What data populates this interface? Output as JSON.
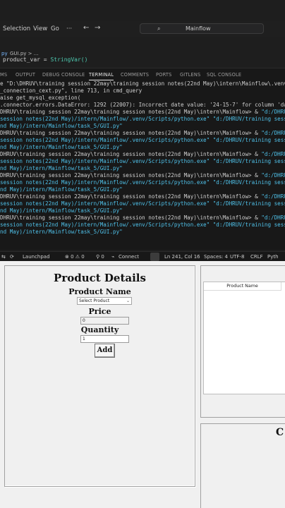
{
  "vscode": {
    "menu": [
      "Selection",
      "View",
      "Go",
      "···"
    ],
    "nav_back": "←",
    "nav_forward": "→",
    "search_text": "Mainflow",
    "tab": {
      "lang_icon": "py",
      "file": "GUI.py",
      "crumb": "GUI.py > ..."
    },
    "code_line": {
      "text": "product_var = ",
      "fn": "StringVar()"
    },
    "panel_tabs": [
      "MS",
      "OUTPUT",
      "DEBUG CONSOLE",
      "TERMINAL",
      "COMMENTS",
      "PORTS",
      "GITLENS",
      "SQL CONSOLE"
    ],
    "active_panel_tab": "TERMINAL",
    "terminal_lines": [
      {
        "t": "e \"D:\\DHRUV\\training session 22may\\training session notes(22nd May)\\intern\\Mainflow\\.venv\\Lib\\",
        "c": ""
      },
      {
        "t": "_connection_cext.py\", line 713, in cmd_query",
        "c": ""
      },
      {
        "t": "aise get_mysql_exception(",
        "c": ""
      },
      {
        "t": ".connector.errors.DataError: 1292 (22007): Incorrect date value: '24-15-7' for column 'date' a",
        "c": ""
      },
      {
        "t": "DHRUV\\training session 22may\\training session notes(22nd May)\\intern\\Mainflow> & \"d:/DHRUV/tr",
        "c": "mix"
      },
      {
        "t": "session notes(22nd May)/intern/Mainflow/.venv/Scripts/python.exe\" \"d:/DHRUV/training session 2",
        "c": "cyan"
      },
      {
        "t": "nd May)/intern/Mainflow/task_5/GUI.py\"",
        "c": "cyan"
      },
      {
        "t": "DHRUV\\training session 22may\\training session notes(22nd May)\\intern\\Mainflow> & \"d:/DHRUV/tr",
        "c": "mix"
      },
      {
        "t": "session notes(22nd May)/intern/Mainflow/.venv/Scripts/python.exe\" \"d:/DHRUV/training session 2",
        "c": "cyan"
      },
      {
        "t": "nd May)/intern/Mainflow/task_5/GUI.py\"",
        "c": "cyan"
      },
      {
        "t": "DHRUV\\training session 22may\\training session notes(22nd May)\\intern\\Mainflow> & \"d:/DHRUV/tr",
        "c": "mix"
      },
      {
        "t": "session notes(22nd May)/intern/Mainflow/.venv/Scripts/python.exe\" \"d:/DHRUV/training session 2",
        "c": "cyan"
      },
      {
        "t": "nd May)/intern/Mainflow/task_5/GUI.py\"",
        "c": "cyan"
      },
      {
        "t": "DHRUV\\training session 22may\\training session notes(22nd May)\\intern\\Mainflow> & \"d:/DHRUV/tr",
        "c": "mix"
      },
      {
        "t": "session notes(22nd May)/intern/Mainflow/.venv/Scripts/python.exe\" \"d:/DHRUV/training session 2",
        "c": "cyan"
      },
      {
        "t": "nd May)/intern/Mainflow/task_5/GUI.py\"",
        "c": "cyan"
      },
      {
        "t": "DHRUV\\training session 22may\\training session notes(22nd May)\\intern\\Mainflow> & \"d:/DHRUV/tr",
        "c": "mix"
      },
      {
        "t": "session notes(22nd May)/intern/Mainflow/.venv/Scripts/python.exe\" \"d:/DHRUV/training session 2",
        "c": "cyan"
      },
      {
        "t": "nd May)/intern/Mainflow/task_5/GUI.py\"",
        "c": "cyan"
      },
      {
        "t": "DHRUV\\training session 22may\\training session notes(22nd May)\\intern\\Mainflow> & \"d:/DHRUV/tr",
        "c": "mix"
      },
      {
        "t": "session notes(22nd May)/intern/Mainflow/.venv/Scripts/python.exe\" \"d:/DHRUV/training session 2",
        "c": "cyan"
      },
      {
        "t": "nd May)/intern/Mainflow/task_5/GUI.py\"",
        "c": "cyan"
      }
    ],
    "status": {
      "launchpad": "Launchpad",
      "errors": "⊗ 0 ⚠ 0",
      "ports": "⚲ 0",
      "connect": "Connect",
      "position": "Ln 241, Col 16",
      "spaces": "Spaces: 4",
      "encoding": "UTF-8",
      "eol": "CRLF",
      "language": "Pyth"
    }
  },
  "gui": {
    "title": "Product Details",
    "product_name_label": "Product Name",
    "product_select_value": "Select Product",
    "price_label": "Price",
    "price_value": "0",
    "quantity_label": "Quantity",
    "quantity_value": "1",
    "add_button": "Add",
    "tree_header": "Product Name",
    "right_partial_title": "C"
  },
  "colors": {
    "terminal_cyan": "#4fc1e9",
    "terminal_text": "#d0d0d0",
    "tk_background": "#f0f0f0"
  }
}
